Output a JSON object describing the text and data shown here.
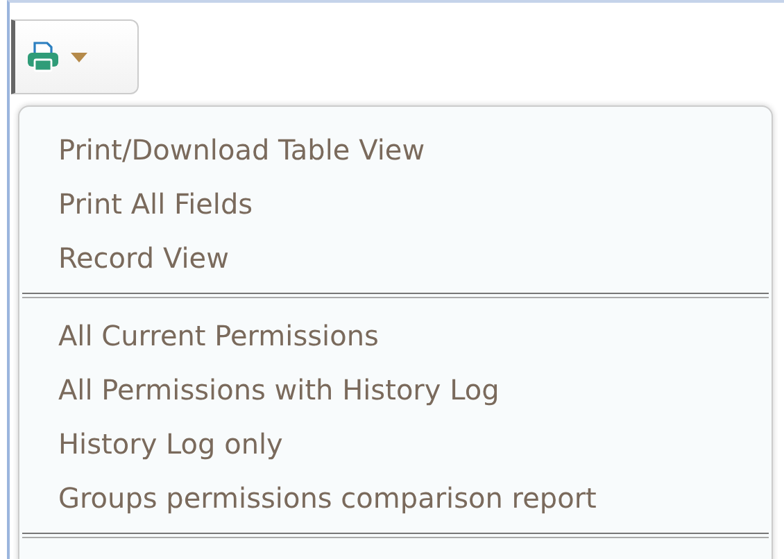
{
  "print_menu": {
    "sections": [
      {
        "items": [
          "Print/Download Table View",
          "Print All Fields",
          "Record View"
        ]
      },
      {
        "items": [
          "All Current Permissions",
          "All Permissions with History Log",
          "History Log only",
          "Groups permissions comparison report"
        ]
      }
    ]
  }
}
